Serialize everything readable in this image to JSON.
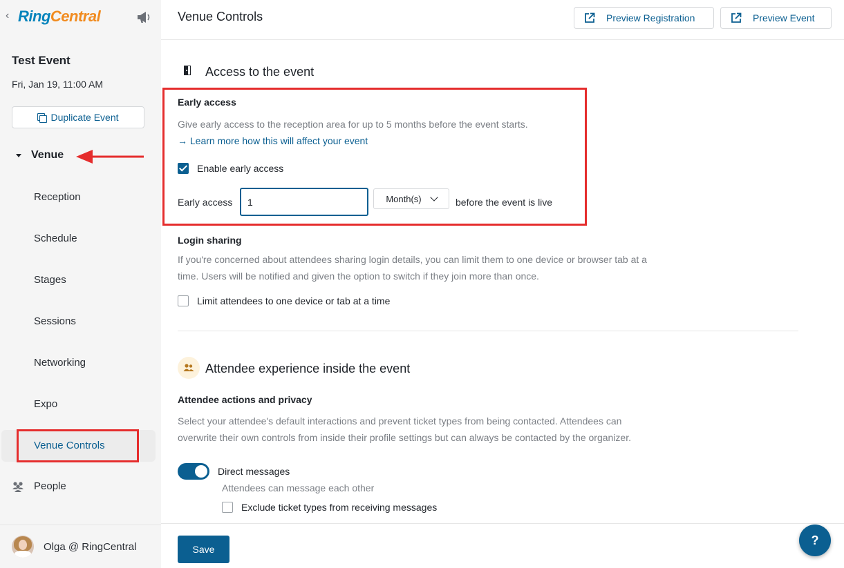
{
  "brand": {
    "ring": "Ring",
    "central": "Central"
  },
  "event": {
    "title": "Test Event",
    "date": "Fri, Jan 19, 11:00 AM"
  },
  "sidebar": {
    "duplicate_label": "Duplicate Event",
    "venue_label": "Venue",
    "items": [
      {
        "label": "Reception"
      },
      {
        "label": "Schedule"
      },
      {
        "label": "Stages"
      },
      {
        "label": "Sessions"
      },
      {
        "label": "Networking"
      },
      {
        "label": "Expo"
      },
      {
        "label": "Venue Controls"
      }
    ],
    "people_label": "People",
    "user_name": "Olga @ RingCentral"
  },
  "header": {
    "title": "Venue Controls",
    "preview_registration": "Preview Registration",
    "preview_event": "Preview Event"
  },
  "access": {
    "section_title": "Access to the event",
    "early_access": {
      "title": "Early access",
      "description": "Give early access to the reception area for up to 5 months before the event starts.",
      "learn_more": "→ Learn more how this will affect your event",
      "enable_label": "Enable early access",
      "enabled": true,
      "field_label": "Early access",
      "value": "1",
      "unit": "Month(s)",
      "suffix": "before the event is live"
    },
    "login_sharing": {
      "title": "Login sharing",
      "description_line1": "If you're concerned about attendees sharing login details, you can limit them to one device or browser tab at a",
      "description_line2": "time. Users will be notified and given the option to switch if they join more than once.",
      "limit_label": "Limit attendees to one device or tab at a time",
      "limit_checked": false
    }
  },
  "experience": {
    "section_title": "Attendee experience inside the event",
    "privacy_title": "Attendee actions and privacy",
    "description_line1": "Select your attendee's default interactions and prevent ticket types from being contacted. Attendees can",
    "description_line2": "overwrite their own controls from inside their profile settings but can always be contacted by the organizer.",
    "direct_messages_label": "Direct messages",
    "direct_messages_on": true,
    "direct_messages_hint": "Attendees can message each other",
    "exclude_label": "Exclude ticket types from receiving messages",
    "exclude_checked": false
  },
  "footer": {
    "save_label": "Save",
    "help_label": "?"
  },
  "colors": {
    "accent": "#0b5f91",
    "highlight": "#e52d2d",
    "brand_blue": "#0684bc",
    "brand_orange": "#f18b1f"
  }
}
